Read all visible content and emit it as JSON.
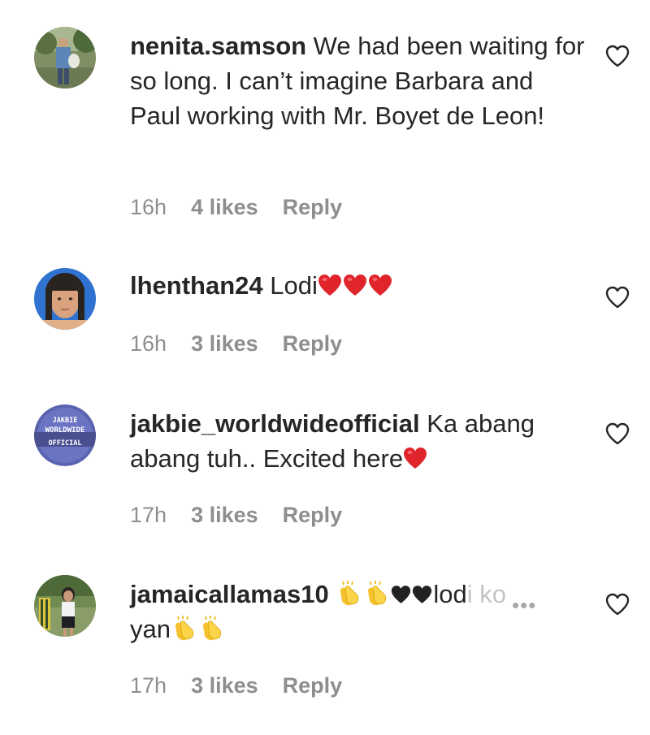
{
  "comments": [
    {
      "username": "nenita.samson",
      "text": " We had been waiting for so long. I can’t imagine Barbara and Paul working with Mr. Boyet de Leon!",
      "time": "16h",
      "likes": "4 likes",
      "reply": "Reply"
    },
    {
      "username": "lhenthan24",
      "text": " Lodi",
      "time": "16h",
      "likes": "3 likes",
      "reply": "Reply"
    },
    {
      "username": "jakbie_worldwideofficial",
      "text": " Ka abang abang tuh.. Excited here",
      "time": "17h",
      "likes": "3 likes",
      "reply": "Reply",
      "avatar_text": [
        "JAKBIE",
        "WORLDWIDE",
        "OFFICIAL"
      ]
    },
    {
      "username": "jamaicallamas10",
      "text_after_emojis": "lod",
      "faded_text": "i ko",
      "text_second_line": "yan",
      "more": "•••",
      "time": "17h",
      "likes": "3 likes",
      "reply": "Reply"
    }
  ],
  "icons": {
    "like": "heart-outline-icon",
    "red_heart": "red-heart-emoji",
    "clap": "clapping-hands-emoji",
    "black_heart": "black-heart-emoji"
  },
  "colors": {
    "text": "#262626",
    "meta": "#8e8e8e",
    "emoji_red": "#e0242b"
  }
}
